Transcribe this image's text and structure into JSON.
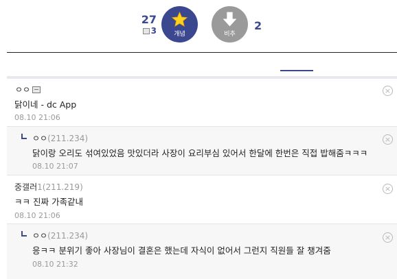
{
  "vote": {
    "up_count": "27",
    "fix_count": "3",
    "up_label": "개념",
    "down_label": "비추",
    "down_count": "2"
  },
  "comments": [
    {
      "nick": "ㅇㅇ",
      "ip": "",
      "text": "닭이네 - dc App",
      "date": "08.10 21:06",
      "is_reply": false
    },
    {
      "nick": "ㅇㅇ",
      "ip": "(211.234)",
      "text": "닭이랑 오리도 섞여있었음 맛있더라 사장이 요리부심 있어서 한달에 한번은 직접 밥해줌ㅋㅋㅋ",
      "date": "08.10 21:07",
      "is_reply": true
    },
    {
      "nick": "중갤러",
      "ip": "1(211.219)",
      "text": "ㅋㅋ 진짜 가족같내",
      "date": "08.10 21:06",
      "is_reply": false
    },
    {
      "nick": "ㅇㅇ",
      "ip": "(211.234)",
      "text": "응ㅋㅋ 분위기 좋아 사장님이 결혼은 했는데 자식이 없어서 그런지 직원들 잘 챙겨줌",
      "date": "08.10 21:32",
      "is_reply": true
    }
  ],
  "colors": {
    "accent": "#3b4890",
    "down": "#9a9a9a",
    "reply_bg": "#f7f7f7"
  },
  "icons": {
    "up": "star-icon",
    "down": "down-arrow-icon",
    "delete": "close-circle-icon"
  }
}
